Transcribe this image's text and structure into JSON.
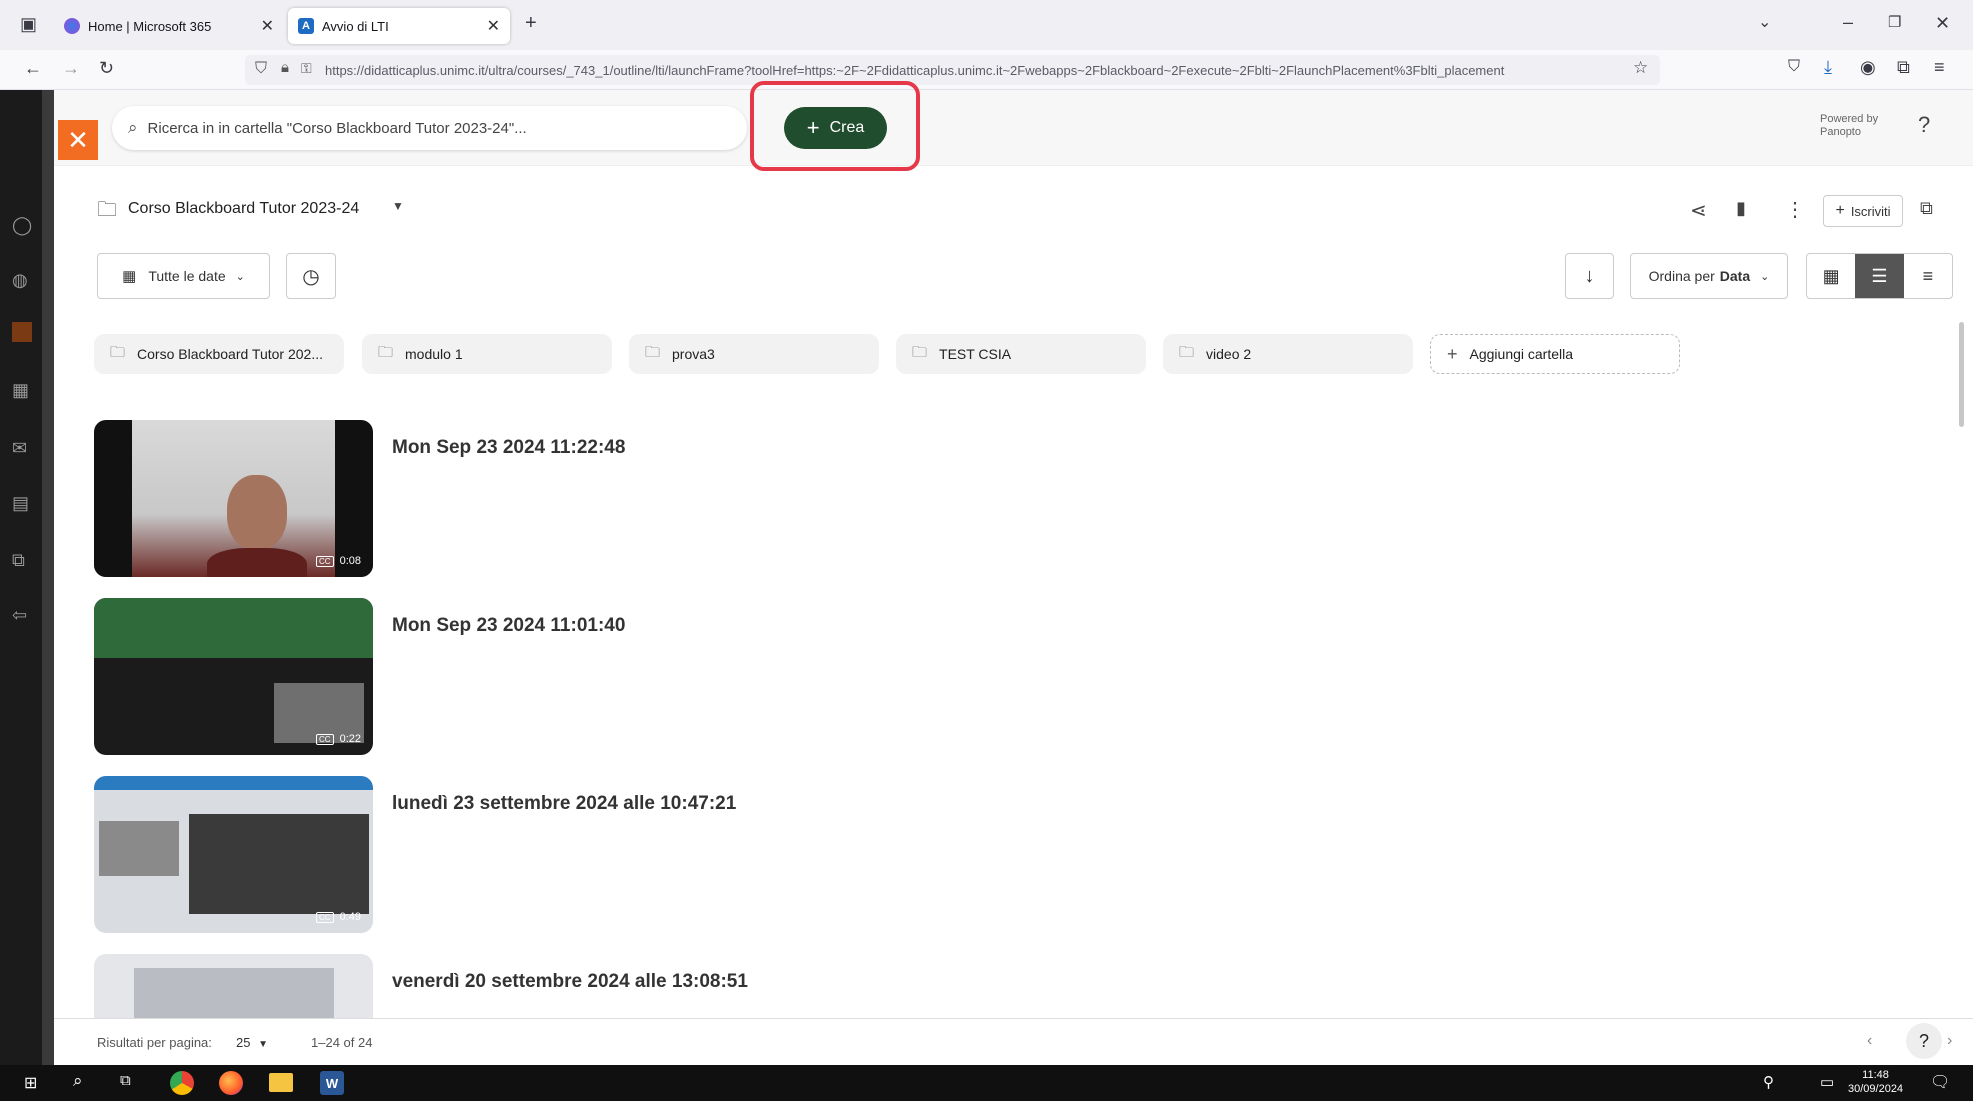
{
  "browser": {
    "tabs": [
      {
        "label": "Home | Microsoft 365",
        "active": false
      },
      {
        "label": "Avvio di LTI",
        "active": true
      }
    ],
    "url": "https://didatticaplus.unimc.it/ultra/courses/_743_1/outline/lti/launchFrame?toolHref=https:~2F~2Fdidatticaplus.unimc.it~2Fwebapps~2Fblackboard~2Fexecute~2Fblti~2FlaunchPlacement%3Fblti_placement"
  },
  "panopto": {
    "search_placeholder": "Ricerca in in cartella \"Corso Blackboard Tutor 2023-24\"...",
    "create_label": "Crea",
    "powered_by_1": "Powered by",
    "powered_by_2": "Panopto",
    "help": "?"
  },
  "folder": {
    "title": "Corso Blackboard Tutor 2023-24",
    "subscribe_label": "Iscriviti",
    "date_filter": "Tutte le date",
    "sort_label": "Ordina per",
    "sort_value": "Data",
    "subfolders": [
      "Corso Blackboard Tutor 202...",
      "modulo 1",
      "prova3",
      "TEST CSIA",
      "video 2"
    ],
    "add_folder_label": "Aggiungi cartella"
  },
  "sessions": [
    {
      "title": "Mon Sep 23 2024 11:22:48",
      "duration": "0:08"
    },
    {
      "title": "Mon Sep 23 2024 11:01:40",
      "duration": "0:22"
    },
    {
      "title": "lunedì 23 settembre 2024 alle 10:47:21",
      "duration": "0:49"
    },
    {
      "title": "venerdì 20 settembre 2024 alle 13:08:51",
      "duration": ""
    }
  ],
  "cc_label": "CC",
  "footer": {
    "results_label": "Risultati per pagina:",
    "per_page": "25",
    "range": "1–24 of 24"
  },
  "taskbar": {
    "time": "11:48",
    "date": "30/09/2024"
  },
  "colors": {
    "accent_orange": "#f26d21",
    "create_green": "#1f4d2e",
    "highlight_red": "#e5394a"
  }
}
